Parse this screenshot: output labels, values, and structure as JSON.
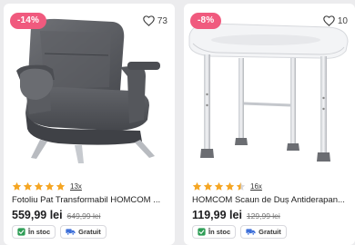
{
  "products": [
    {
      "discount_badge": "-14%",
      "favorites_count": "73",
      "image_icon": "armchair-sofa-bed-photo",
      "stars": 5,
      "review_count": "13x",
      "title": "Fotoliu Pat Transformabil HOMCOM ...",
      "price": "559,99 lei",
      "old_price": "649,99 lei",
      "stock_label": "În stoc",
      "shipping_label": "Gratuit"
    },
    {
      "discount_badge": "-8%",
      "favorites_count": "10",
      "image_icon": "shower-stool-photo",
      "stars": 4.5,
      "review_count": "16x",
      "title": "HOMCOM Scaun de Duș Antiderapan...",
      "price": "119,99 lei",
      "old_price": "129,99 lei",
      "stock_label": "În stoc",
      "shipping_label": "Gratuit"
    }
  ],
  "colors": {
    "badge": "#f05a7e",
    "star": "#f5a623",
    "stock_icon": "#2e9d56",
    "shipping_icon": "#3d6fd9"
  }
}
